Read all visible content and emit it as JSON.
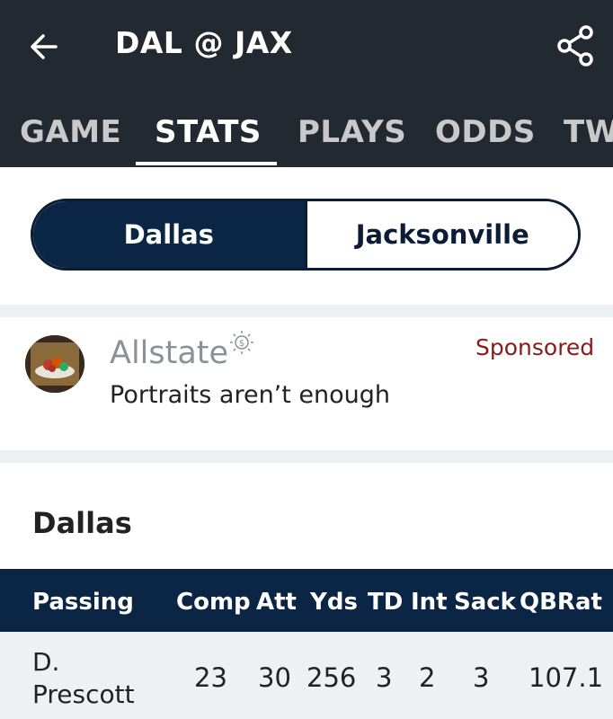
{
  "header": {
    "title": "DAL @ JAX",
    "back_icon": "arrow-left-icon",
    "share_icon": "share-icon"
  },
  "tabs": [
    {
      "label": "GAME",
      "active": false
    },
    {
      "label": "STATS",
      "active": true
    },
    {
      "label": "PLAYS",
      "active": false
    },
    {
      "label": "ODDS",
      "active": false
    },
    {
      "label": "TW",
      "active": false
    }
  ],
  "team_toggle": {
    "selected": "Dallas",
    "options": [
      "Dallas",
      "Jacksonville"
    ]
  },
  "ad": {
    "brand": "Allstate",
    "sponsored_label": "Sponsored",
    "text": "Portraits aren’t enough"
  },
  "team_section": {
    "heading": "Dallas"
  },
  "passing_table": {
    "columns": [
      "Passing",
      "Comp",
      "Att",
      "Yds",
      "TD",
      "Int",
      "Sack",
      "QBRat"
    ],
    "rows": [
      {
        "player_line1": "D.",
        "player_line2": "Prescott",
        "comp": "23",
        "att": "30",
        "yds": "256",
        "td": "3",
        "int": "2",
        "sack": "3",
        "qbrat": "107.1"
      }
    ]
  },
  "colors": {
    "header_bg": "#232931",
    "navy": "#0b2545",
    "sponsored": "#8a1a1a"
  }
}
